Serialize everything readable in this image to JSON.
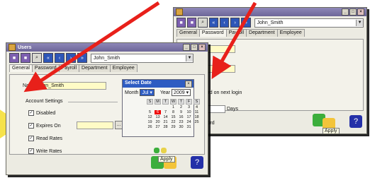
{
  "back_window": {
    "user_combo": "John_Smith",
    "tabs": [
      "General",
      "Password",
      "Payroll",
      "Department",
      "Employee"
    ],
    "active_tab": "Password",
    "text_change_password": "ge password on next login",
    "text_tor": "tor",
    "days_label": "Days",
    "text_nge": "nge password",
    "apply_label": "Apply"
  },
  "front_window": {
    "title": "Users",
    "user_combo": "John_Smith",
    "tabs": [
      "General",
      "Password",
      "Payroll",
      "Department",
      "Employee"
    ],
    "active_tab": "General",
    "name_label": "Name",
    "name_value": "John_Smith",
    "account_settings_label": "Account Settings",
    "checks": [
      {
        "label": "Disabled",
        "checked": true
      },
      {
        "label": "Expires On",
        "checked": true
      },
      {
        "label": "Read Rates",
        "checked": true
      },
      {
        "label": "Write Rates",
        "checked": true
      }
    ],
    "apply_label": "Apply"
  },
  "calendar": {
    "title": "Select Date",
    "month_label": "Month",
    "month_value": "Jul",
    "year_label": "Year",
    "year_value": "2009",
    "weekday_headers": [
      "S",
      "M",
      "T",
      "W",
      "T",
      "F",
      "S"
    ],
    "days": [
      "",
      "",
      "",
      "1",
      "2",
      "3",
      "4",
      "5",
      "6",
      "7",
      "8",
      "9",
      "10",
      "11",
      "12",
      "13",
      "14",
      "15",
      "16",
      "17",
      "18",
      "19",
      "20",
      "21",
      "22",
      "23",
      "24",
      "25",
      "26",
      "27",
      "28",
      "29",
      "30",
      "31",
      ""
    ],
    "selected_day": "6"
  },
  "colors": {
    "arrow": "#e8201a",
    "accent_yellow": "#f6e24a",
    "titlebar": "#6d6698",
    "toolbar_blue": "#2e56b8"
  }
}
